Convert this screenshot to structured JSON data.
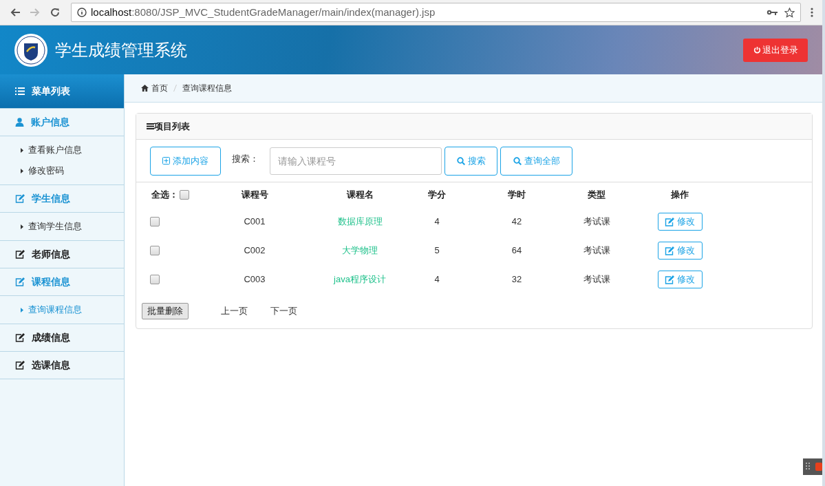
{
  "browser": {
    "url_host": "localhost",
    "url_rest": ":8080/JSP_MVC_StudentGradeManager/main/index(manager).jsp"
  },
  "header": {
    "title": "学生成绩管理系统",
    "logout": "退出登录"
  },
  "sidebar": {
    "title": "菜单列表",
    "sections": [
      {
        "label": "账户信息",
        "kind": "account",
        "expanded": true,
        "children": [
          {
            "label": "查看账户信息",
            "selected": false
          },
          {
            "label": "修改密码",
            "selected": false
          }
        ]
      },
      {
        "label": "学生信息",
        "kind": "module",
        "expanded": true,
        "children": [
          {
            "label": "查询学生信息",
            "selected": false
          }
        ]
      },
      {
        "label": "老师信息",
        "kind": "module",
        "expanded": false
      },
      {
        "label": "课程信息",
        "kind": "module",
        "expanded": true,
        "children": [
          {
            "label": "查询课程信息",
            "selected": true
          }
        ]
      },
      {
        "label": "成绩信息",
        "kind": "module",
        "expanded": false
      },
      {
        "label": "选课信息",
        "kind": "module",
        "expanded": false
      }
    ]
  },
  "breadcrumb": [
    "首页",
    "查询课程信息"
  ],
  "panel": {
    "title": "项目列表",
    "add_button": "添加内容",
    "search_label": "搜索：",
    "search_placeholder": "请输入课程号",
    "search_button": "搜索",
    "query_all_button": "查询全部"
  },
  "table": {
    "select_all_label": "全选：",
    "select_all_checked": false,
    "columns": [
      "课程号",
      "课程名",
      "学分",
      "学时",
      "类型",
      "操作"
    ],
    "rows": [
      {
        "checked": false,
        "cells": [
          "C001",
          "数据库原理",
          "4",
          "42",
          "考试课"
        ],
        "action": "修改"
      },
      {
        "checked": false,
        "cells": [
          "C002",
          "大学物理",
          "5",
          "64",
          "考试课"
        ],
        "action": "修改"
      },
      {
        "checked": false,
        "cells": [
          "C003",
          "java程序设计",
          "4",
          "32",
          "考试课"
        ],
        "action": "修改"
      }
    ]
  },
  "footer": {
    "batch_delete": "批量删除",
    "prev": "上一页",
    "next": "下一页"
  }
}
